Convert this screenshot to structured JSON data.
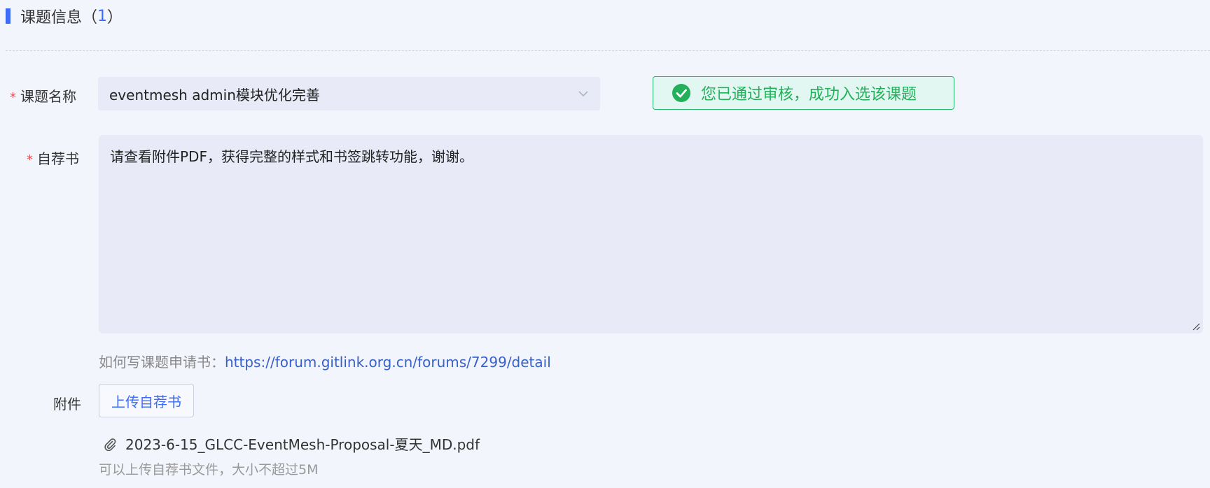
{
  "section": {
    "title": "课题信息",
    "paren_open": "（",
    "count": "1",
    "paren_close": "）"
  },
  "form": {
    "topic_label": "课题名称",
    "topic_value": "eventmesh admin模块优化完善",
    "status_message": "您已通过审核，成功入选该课题",
    "statement_label": "自荐书",
    "statement_text": "请查看附件PDF，获得完整的样式和书签跳转功能，谢谢。",
    "hint_prefix": "如何写课题申请书：",
    "hint_link": "https://forum.gitlink.org.cn/forums/7299/detail",
    "attachment_label": "附件",
    "upload_button": "上传自荐书",
    "file_name": "2023-6-15_GLCC-EventMesh-Proposal-夏天_MD.pdf",
    "upload_note": "可以上传自荐书文件，大小不超过5M",
    "required_mark": "*"
  },
  "colors": {
    "accent": "#3d6bf5",
    "success": "#22b05a",
    "required": "#e84c4c",
    "link": "#3860c8"
  },
  "icons": {
    "status": "check-circle-icon",
    "select": "chevron-down-icon",
    "file": "paperclip-icon",
    "resize": "resize-handle-icon"
  }
}
